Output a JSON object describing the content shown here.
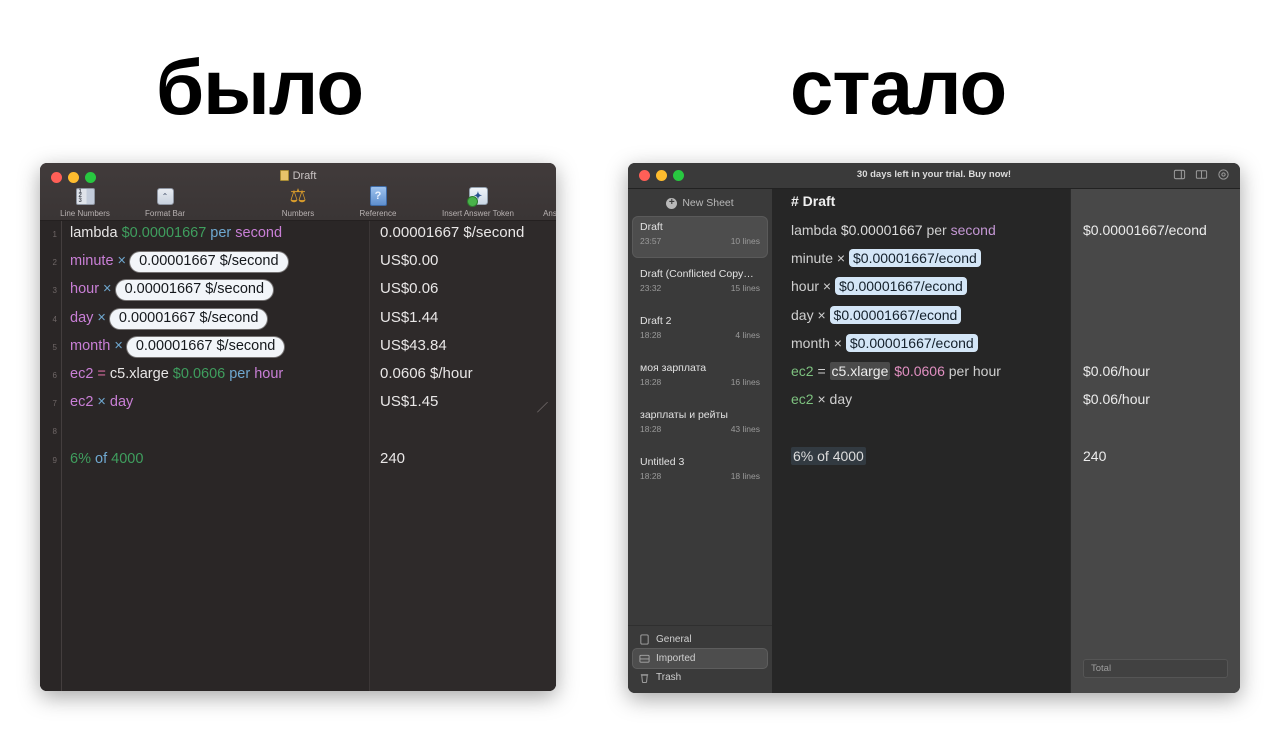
{
  "headlines": {
    "before": "было",
    "after": "стало"
  },
  "left_window": {
    "title": "Draft",
    "doc_icon": "document-icon",
    "traffic_lights": [
      "close",
      "minimize",
      "zoom"
    ],
    "toolbar": [
      {
        "label": "Line Numbers",
        "icon": "line-numbers-icon"
      },
      {
        "label": "Format Bar",
        "icon": "format-bar-icon"
      },
      {
        "label": "Numbers",
        "icon": "scales-icon"
      },
      {
        "label": "Reference",
        "icon": "reference-book-icon"
      },
      {
        "label": "Insert Answer Token",
        "icon": "insert-answer-token-icon"
      },
      {
        "label": "Answer Palette",
        "icon": "answer-palette-icon"
      }
    ],
    "line_numbers": [
      "1",
      "2",
      "3",
      "4",
      "5",
      "6",
      "7",
      "8",
      "9"
    ],
    "lines": [
      {
        "n": "1",
        "parts": [
          {
            "t": "lambda ",
            "c": "plain"
          },
          {
            "t": "$0.00001667",
            "c": "money"
          },
          {
            "t": " per ",
            "c": "op"
          },
          {
            "t": "second",
            "c": "unit"
          }
        ]
      },
      {
        "n": "2",
        "parts": [
          {
            "t": "minute",
            "c": "var"
          },
          {
            "t": " × ",
            "c": "op"
          },
          {
            "t": "0.00001667 $/second",
            "c": "pill"
          }
        ]
      },
      {
        "n": "3",
        "parts": [
          {
            "t": "hour",
            "c": "var"
          },
          {
            "t": " × ",
            "c": "op"
          },
          {
            "t": "0.00001667 $/second",
            "c": "pill"
          }
        ]
      },
      {
        "n": "4",
        "parts": [
          {
            "t": "day",
            "c": "var"
          },
          {
            "t": " × ",
            "c": "op"
          },
          {
            "t": "0.00001667 $/second",
            "c": "pill"
          }
        ]
      },
      {
        "n": "5",
        "parts": [
          {
            "t": "month",
            "c": "var"
          },
          {
            "t": " × ",
            "c": "op"
          },
          {
            "t": "0.00001667 $/second",
            "c": "pill"
          }
        ]
      },
      {
        "n": "6",
        "parts": [
          {
            "t": "ec2",
            "c": "var"
          },
          {
            "t": " = ",
            "c": "eq"
          },
          {
            "t": "c5.xlarge ",
            "c": "plain"
          },
          {
            "t": "$0.0606",
            "c": "money"
          },
          {
            "t": " per ",
            "c": "op"
          },
          {
            "t": "hour",
            "c": "unit"
          }
        ]
      },
      {
        "n": "7",
        "parts": [
          {
            "t": "ec2",
            "c": "var"
          },
          {
            "t": " × ",
            "c": "op"
          },
          {
            "t": "day",
            "c": "unit"
          }
        ]
      },
      {
        "n": "8",
        "parts": []
      },
      {
        "n": "9",
        "parts": [
          {
            "t": "6% ",
            "c": "pct"
          },
          {
            "t": "of ",
            "c": "op"
          },
          {
            "t": "4000",
            "c": "pct"
          }
        ]
      }
    ],
    "results": [
      "0.00001667 $/second",
      "US$0.00",
      "US$0.06",
      "US$1.44",
      "US$43.84",
      "0.0606 $/hour",
      "US$1.45",
      "",
      "240"
    ]
  },
  "right_window": {
    "trial_banner": "30 days left in your trial. Buy now!",
    "traffic_lights": [
      "close",
      "minimize",
      "zoom"
    ],
    "window_buttons": [
      {
        "icon": "panel-toggle-icon"
      },
      {
        "icon": "reference-book-icon"
      },
      {
        "icon": "gear-icon"
      }
    ],
    "sidebar": {
      "new_sheet_label": "New Sheet",
      "new_sheet_icon": "plus-circle-icon",
      "sheets": [
        {
          "name": "Draft",
          "time": "23:57",
          "lines": "10 lines",
          "selected": true
        },
        {
          "name": "Draft (Conflicted Copy…",
          "time": "23:32",
          "lines": "15 lines",
          "selected": false
        },
        {
          "name": "Draft 2",
          "time": "18:28",
          "lines": "4 lines",
          "selected": false
        },
        {
          "name": "моя зарплата",
          "time": "18:28",
          "lines": "16 lines",
          "selected": false
        },
        {
          "name": "зарплаты и рейты",
          "time": "18:28",
          "lines": "43 lines",
          "selected": false
        },
        {
          "name": "Untitled 3",
          "time": "18:28",
          "lines": "18 lines",
          "selected": false
        }
      ],
      "folders": [
        {
          "label": "General",
          "icon": "document-icon",
          "selected": false
        },
        {
          "label": "Imported",
          "icon": "inbox-icon",
          "selected": true
        },
        {
          "label": "Trash",
          "icon": "trash-icon",
          "selected": false
        }
      ]
    },
    "doc_title": "# Draft",
    "lines": [
      {
        "parts": [
          {
            "t": "lambda ",
            "c": "dim"
          },
          {
            "t": "$0.00001667",
            "c": "plainw"
          },
          {
            "t": " per ",
            "c": "dim"
          },
          {
            "t": "second",
            "c": "sec"
          }
        ]
      },
      {
        "parts": [
          {
            "t": "minute",
            "c": "dim"
          },
          {
            "t": " × ",
            "c": "dim"
          },
          {
            "t": "$0.00001667/econd",
            "c": "pill"
          }
        ]
      },
      {
        "parts": [
          {
            "t": "hour",
            "c": "dim"
          },
          {
            "t": " × ",
            "c": "dim"
          },
          {
            "t": "$0.00001667/econd",
            "c": "pill"
          }
        ]
      },
      {
        "parts": [
          {
            "t": "day",
            "c": "dim"
          },
          {
            "t": " × ",
            "c": "dim"
          },
          {
            "t": "$0.00001667/econd",
            "c": "pill"
          }
        ]
      },
      {
        "parts": [
          {
            "t": "month",
            "c": "dim"
          },
          {
            "t": " × ",
            "c": "dim"
          },
          {
            "t": "$0.00001667/econd",
            "c": "pill"
          }
        ]
      },
      {
        "parts": [
          {
            "t": "ec2",
            "c": "grn"
          },
          {
            "t": " = ",
            "c": "dim"
          },
          {
            "t": "c5.xlarge",
            "c": "greyhl"
          },
          {
            "t": " ",
            "c": "dim"
          },
          {
            "t": "$0.0606",
            "c": "mag"
          },
          {
            "t": " per hour",
            "c": "dim"
          }
        ]
      },
      {
        "parts": [
          {
            "t": "ec2",
            "c": "grn"
          },
          {
            "t": " × day",
            "c": "dim"
          }
        ]
      },
      {
        "parts": []
      },
      {
        "parts": [
          {
            "t": "6% of 4000",
            "c": "faintblue"
          }
        ]
      }
    ],
    "results": [
      "$0.00001667/econd",
      "",
      "",
      "",
      "",
      "$0.06/hour",
      "$0.06/hour",
      "",
      "240"
    ],
    "total_placeholder": "Total"
  }
}
